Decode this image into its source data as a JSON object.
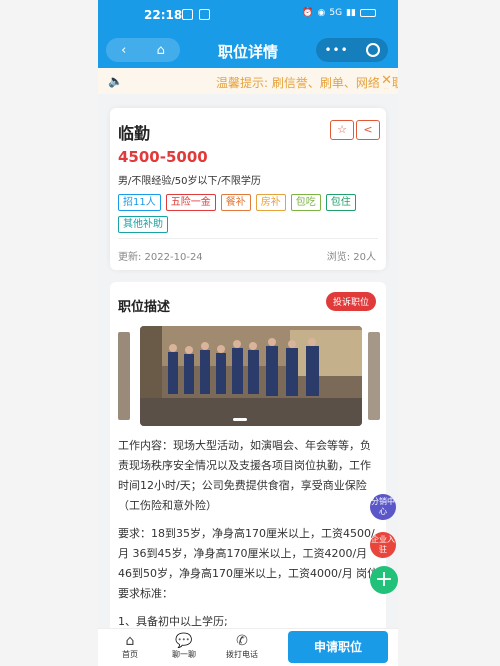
{
  "status": {
    "time": "22:18",
    "signal": "5G",
    "battery_icon": "battery-icon"
  },
  "navbar": {
    "back_icon": "‹",
    "home_icon": "⌂",
    "title": "职位详情",
    "more": "•••"
  },
  "notice": {
    "text": "温馨提示: 刷信誉、刷单、网络兼职",
    "close": "✕"
  },
  "job": {
    "title": "临勤",
    "salary": "4500-5000",
    "requirements": "男/不限经验/50岁以下/不限学历",
    "tags": [
      {
        "label": "招11人",
        "color": "#1a9be8"
      },
      {
        "label": "五险一金",
        "color": "#e03a3a"
      },
      {
        "label": "餐补",
        "color": "#e07a3a"
      },
      {
        "label": "房补",
        "color": "#e6a23c"
      },
      {
        "label": "包吃",
        "color": "#7cb342"
      },
      {
        "label": "包住",
        "color": "#22a06b"
      },
      {
        "label": "其他补助",
        "color": "#1aa3a3"
      }
    ],
    "updated": "更新: 2022-10-24",
    "views": "浏览: 20人"
  },
  "description": {
    "title": "职位描述",
    "complain": "投诉职位",
    "paragraphs": [
      "工作内容：现场大型活动，如演唱会、年会等等，负责现场秩序安全情况以及支援各项目岗位执勤，工作时间12小时/天；公司免费提供食宿，享受商业保险（工伤险和意外险）",
      "要求：18到35岁，净身高170厘米以上，工资4500/月 36到45岁，净身高170厘米以上，工资4200/月 46到50岁，净身高170厘米以上，工资4000/月 岗位要求标准：",
      "1、具备初中以上学历;"
    ]
  },
  "fabs": {
    "share": "分销中心",
    "complaint": "企业入驻",
    "plus": "+"
  },
  "bottom": {
    "home": "首页",
    "chat": "聊一聊",
    "call": "拨打电话",
    "apply": "申请职位"
  }
}
